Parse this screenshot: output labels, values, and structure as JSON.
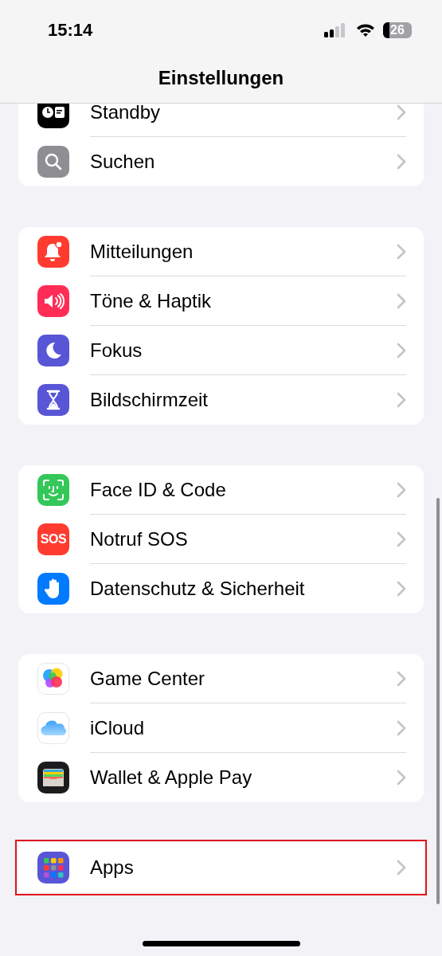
{
  "status_bar": {
    "time": "15:14",
    "battery": "26"
  },
  "navigation": {
    "title": "Einstellungen"
  },
  "groups": [
    {
      "items": [
        {
          "label": "Standby",
          "highlighted": false
        },
        {
          "label": "Suchen",
          "highlighted": false
        }
      ]
    },
    {
      "items": [
        {
          "label": "Mitteilungen",
          "highlighted": false
        },
        {
          "label": "Töne & Haptik",
          "highlighted": false
        },
        {
          "label": "Fokus",
          "highlighted": false
        },
        {
          "label": "Bildschirmzeit",
          "highlighted": false
        }
      ]
    },
    {
      "items": [
        {
          "label": "Face ID & Code",
          "highlighted": false
        },
        {
          "label": "Notruf SOS",
          "icon_text": "SOS",
          "highlighted": false
        },
        {
          "label": "Datenschutz & Sicherheit",
          "highlighted": false
        }
      ]
    },
    {
      "items": [
        {
          "label": "Game Center",
          "highlighted": false
        },
        {
          "label": "iCloud",
          "highlighted": false
        },
        {
          "label": "Wallet & Apple Pay",
          "highlighted": false
        }
      ]
    },
    {
      "items": [
        {
          "label": "Apps",
          "highlighted": true
        }
      ]
    }
  ]
}
